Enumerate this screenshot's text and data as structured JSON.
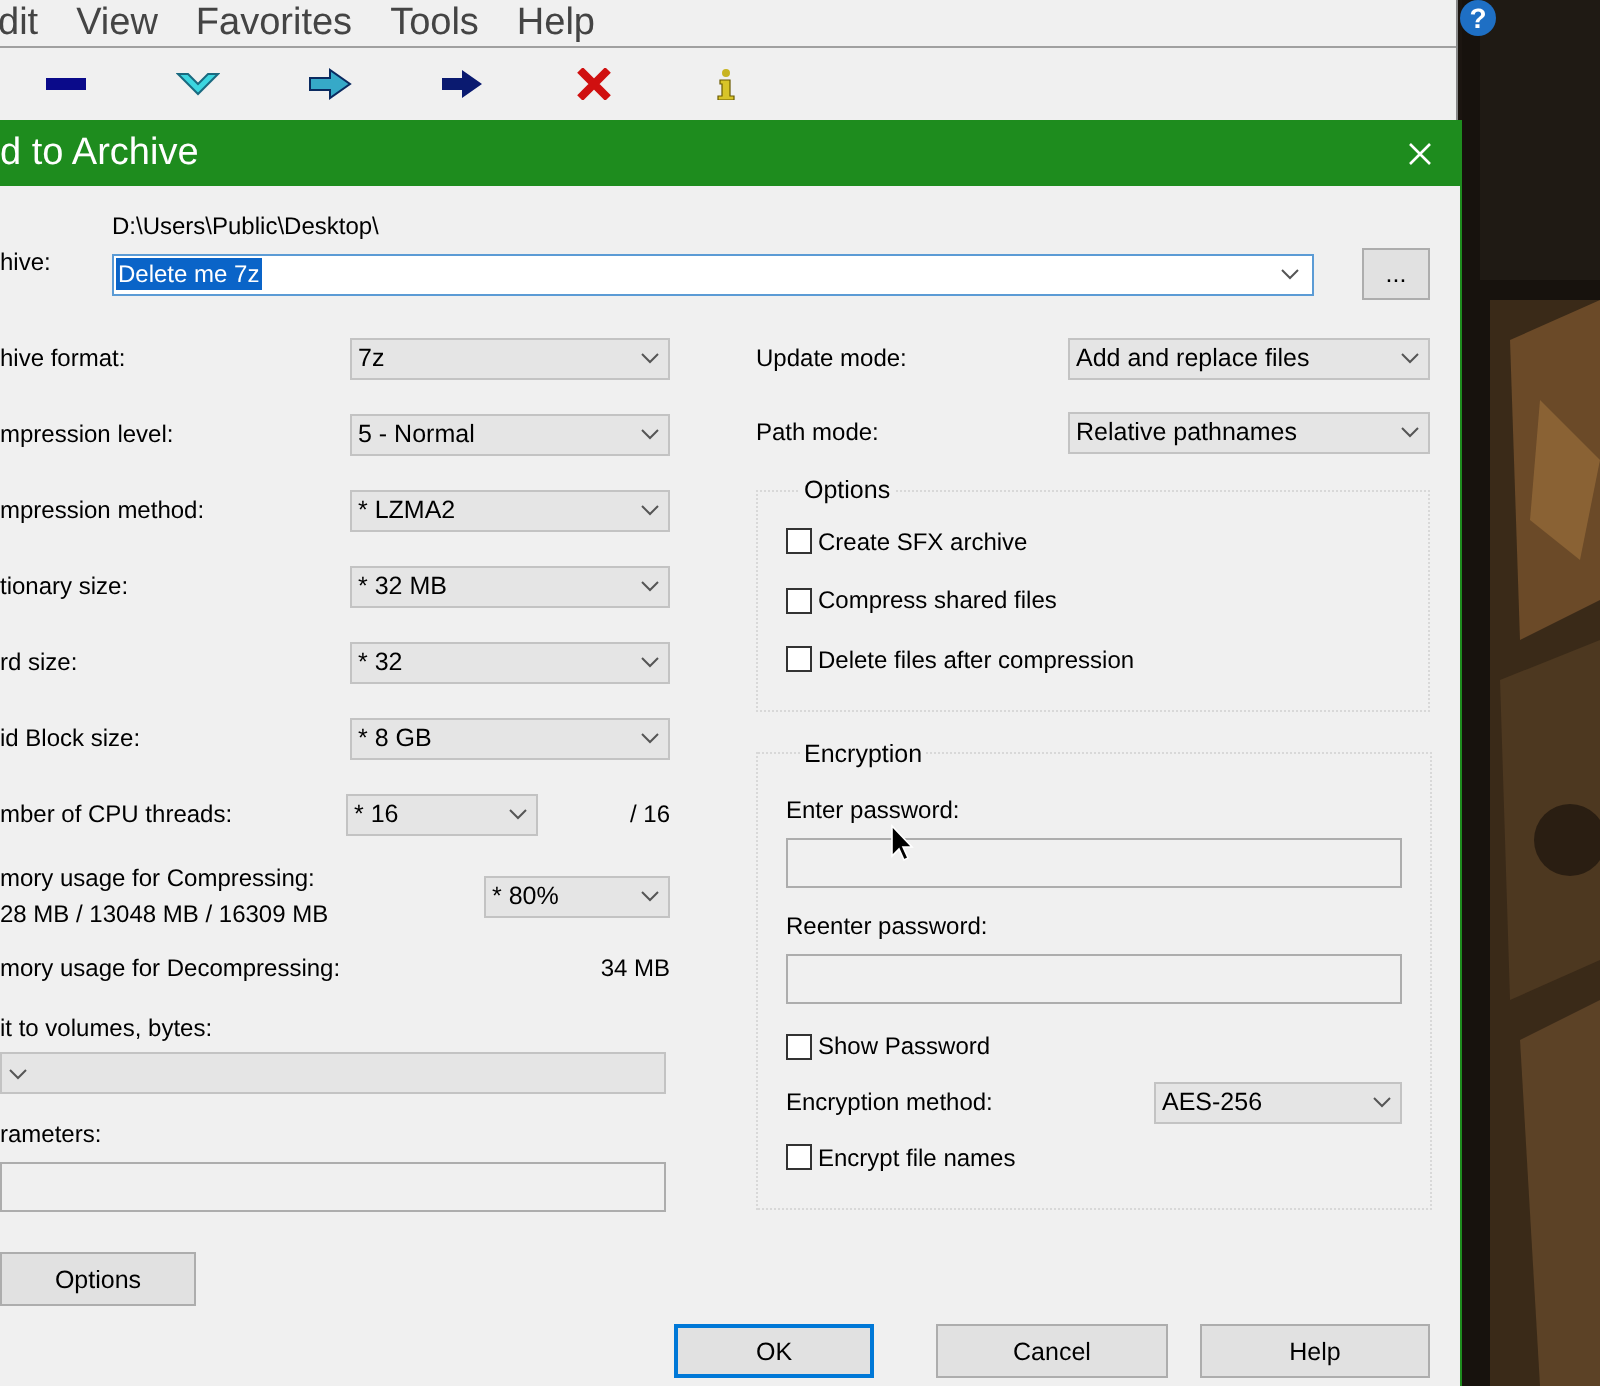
{
  "background_window": {
    "menu": [
      "dit",
      "View",
      "Favorites",
      "Tools",
      "Help"
    ]
  },
  "help_badge": "?",
  "dialog": {
    "title": "d to Archive",
    "archive": {
      "label": "hive:",
      "path": "D:\\Users\\Public\\Desktop\\",
      "value": "Delete me 7z",
      "highlighted": true
    },
    "browse_button": "...",
    "left_rows": [
      {
        "kind": "combo",
        "label": "hive format:",
        "value": "7z"
      },
      {
        "kind": "combo",
        "label": "mpression level:",
        "value": "5 - Normal"
      },
      {
        "kind": "combo",
        "label": "mpression method:",
        "value": "* LZMA2"
      },
      {
        "kind": "combo",
        "label": "tionary size:",
        "value": "* 32 MB"
      },
      {
        "kind": "combo",
        "label": "rd size:",
        "value": "* 32"
      },
      {
        "kind": "combo",
        "label": "id Block size:",
        "value": "* 8 GB"
      },
      {
        "kind": "threads",
        "label": "mber of CPU threads:",
        "value": "* 16",
        "note": "/ 16"
      },
      {
        "kind": "memory",
        "label": "mory usage for Compressing:",
        "detail": "28 MB / 13048 MB / 16309 MB",
        "value": "* 80%"
      },
      {
        "kind": "reading",
        "label": "mory usage for Decompressing:",
        "value": "34 MB"
      }
    ],
    "split_label": "it to volumes, bytes:",
    "parameters_label": "rameters:",
    "options_button": "Options",
    "update_mode": {
      "label": "Update mode:",
      "value": "Add and replace files"
    },
    "path_mode": {
      "label": "Path mode:",
      "value": "Relative pathnames"
    },
    "options_group": {
      "title": "Options",
      "checkboxes": [
        {
          "label": "Create SFX archive",
          "checked": false
        },
        {
          "label": "Compress shared files",
          "checked": false
        },
        {
          "label": "Delete files after compression",
          "checked": false
        }
      ]
    },
    "encryption": {
      "title": "Encryption",
      "password_label": "Enter password:",
      "reenter_label": "Reenter password:",
      "show_password": {
        "label": "Show Password",
        "checked": false
      },
      "method_label": "Encryption method:",
      "method_value": "AES-256",
      "encrypt_names": {
        "label": "Encrypt file names",
        "checked": false
      }
    },
    "buttons": [
      {
        "label": "OK",
        "focused": true
      },
      {
        "label": "Cancel",
        "focused": false
      },
      {
        "label": "Help",
        "focused": false
      }
    ]
  }
}
